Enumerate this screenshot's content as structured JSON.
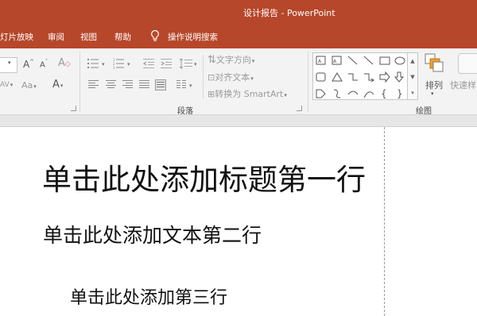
{
  "window": {
    "title": "设计报告 - PowerPoint"
  },
  "colors": {
    "accent": "#b7472a",
    "ribbon_bg": "#f3f3f3",
    "slide_bg": "#ffffff"
  },
  "tabs": [
    {
      "label": "灯片放映"
    },
    {
      "label": "审阅"
    },
    {
      "label": "视图"
    },
    {
      "label": "帮助"
    }
  ],
  "tell_me": {
    "label": "操作说明搜索",
    "icon": "lightbulb-icon"
  },
  "ribbon": {
    "font": {
      "grow_label": "A",
      "shrink_label": "A",
      "clear_label": "A",
      "spacing_label": "AV",
      "case_label": "Aa",
      "color_label": "A"
    },
    "paragraph": {
      "group_label": "段落",
      "text_direction": "文字方向",
      "align_text": "对齐文本",
      "convert_smartart": "转换为 SmartArt"
    },
    "drawing": {
      "group_label": "绘图",
      "arrange": "排列",
      "quick_styles": "快速样"
    }
  },
  "slide": {
    "title": "单击此处添加标题第一行",
    "line2": "单击此处添加文本第二行",
    "line3": "单击此处添加第三行"
  }
}
